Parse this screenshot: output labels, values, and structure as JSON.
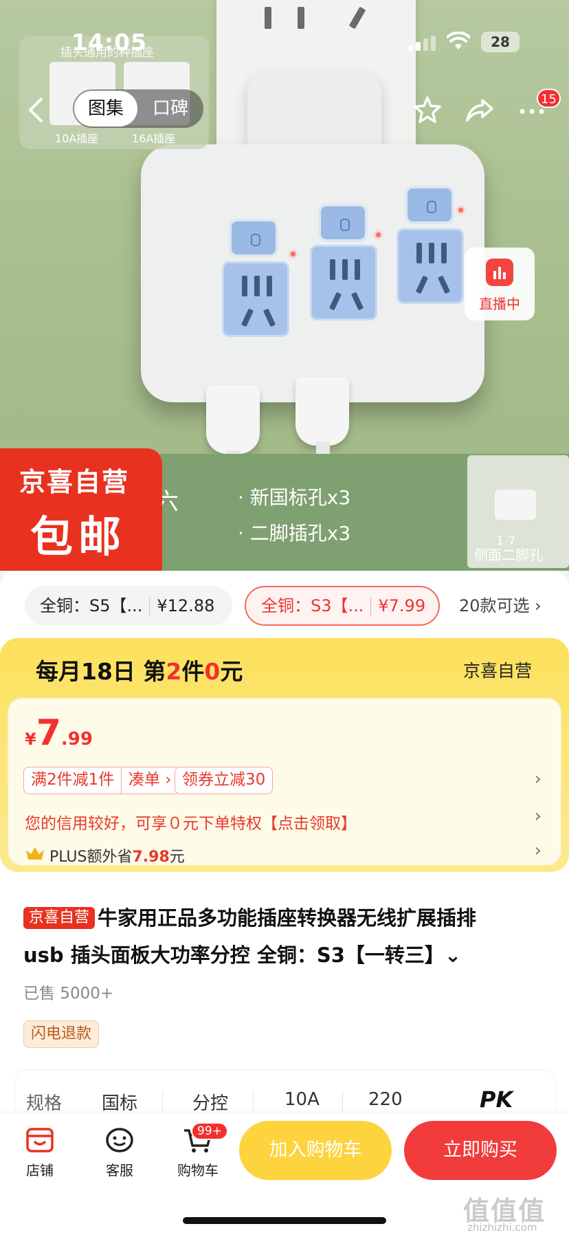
{
  "status_bar": {
    "time": "14:05",
    "battery": "28"
  },
  "top_nav": {
    "tabs": [
      {
        "label": "图集",
        "active": true
      },
      {
        "label": "口碑",
        "active": false
      }
    ],
    "cart_badge": "15"
  },
  "hero": {
    "inset_caption": "插头通用的种插座",
    "inset_labels": [
      "10A插座",
      "16A插座"
    ],
    "live_label": "直播中",
    "banner_lines": [
      "· 新国标孔x3",
      "· 二脚插孔x3"
    ],
    "banner_left_char": "六",
    "badge_line1": "京喜自营",
    "badge_line2": "包邮",
    "thumb_caption": "侧面二脚孔",
    "pager": "1 7"
  },
  "variants": [
    {
      "name": "全铜：S5【...",
      "price": "¥12.88",
      "selected": false
    },
    {
      "name": "全铜：S3【...",
      "price": "¥7.99",
      "selected": true
    }
  ],
  "variants_more": "20款可选 ›",
  "promo": {
    "title_parts": [
      "每月18日 第",
      "2",
      "件",
      "0",
      "元"
    ],
    "brand": "京喜自营",
    "price_currency": "¥",
    "price_int": "7",
    "price_dec": ".99",
    "tags": [
      "满2件减1件",
      "凑单 ›",
      "领券立减30"
    ],
    "credit_text": "您的信用较好，可享０元下单特权【点击领取】",
    "plus_prefix": "PLUS额外省",
    "plus_amount": "7.98",
    "plus_suffix": "元"
  },
  "product": {
    "store_tag": "京喜自营",
    "title_line1": "牛家用正品多功能插座转换器无线扩展插排",
    "title_line2": "usb 插头面板大功率分控 全铜：S3【一转三】⌄",
    "sold": "已售 5000+",
    "service_tag": "闪电退款"
  },
  "specs": {
    "head": "规格",
    "values": [
      "国标",
      "分控",
      "10A",
      "220"
    ],
    "pk": "PK"
  },
  "bottom_bar": {
    "store": "店铺",
    "service": "客服",
    "cart": "购物车",
    "cart_badge": "99+",
    "add_to_cart": "加入购物车",
    "buy_now": "立即购买"
  },
  "watermark": {
    "main": "值值值",
    "sub": "zhizhizhi.com"
  },
  "colors": {
    "accent_red": "#f23030",
    "promo_yellow": "#fde05a",
    "cart_yellow": "#fdd33e",
    "jx_red": "#e8321f"
  }
}
